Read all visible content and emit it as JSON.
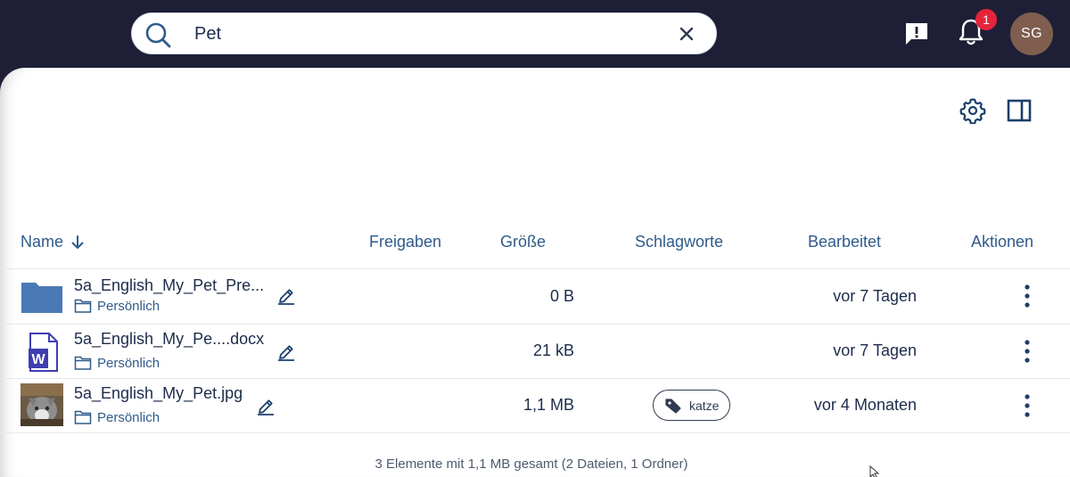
{
  "search": {
    "value": "Pet",
    "placeholder": ""
  },
  "topbar": {
    "notification_count": "1",
    "avatar_initials": "SG"
  },
  "table": {
    "headers": {
      "name": "Name",
      "shares": "Freigaben",
      "size": "Größe",
      "tags": "Schlagworte",
      "modified": "Bearbeitet",
      "actions": "Aktionen"
    },
    "rows": [
      {
        "name": "5a_English_My_Pet_Pre...",
        "location": "Persönlich",
        "size": "0 B",
        "tag": "",
        "modified": "vor 7 Tagen",
        "icon": "folder-icon"
      },
      {
        "name": "5a_English_My_Pe....docx",
        "location": "Persönlich",
        "size": "21 kB",
        "tag": "",
        "modified": "vor 7 Tagen",
        "icon": "word-document-icon"
      },
      {
        "name": "5a_English_My_Pet.jpg",
        "location": "Persönlich",
        "size": "1,1 MB",
        "tag": "katze",
        "modified": "vor 4 Monaten",
        "icon": "image-thumbnail"
      }
    ],
    "summary": "3 Elemente mit 1,1 MB gesamt (2 Dateien, 1 Ordner)"
  },
  "colors": {
    "topbar": "#1e1f36",
    "accent": "#2f5b8a",
    "badge": "#e5243b",
    "avatar": "#7f5e4f",
    "folder": "#4a7ab5",
    "word": "#3e3eb0"
  }
}
